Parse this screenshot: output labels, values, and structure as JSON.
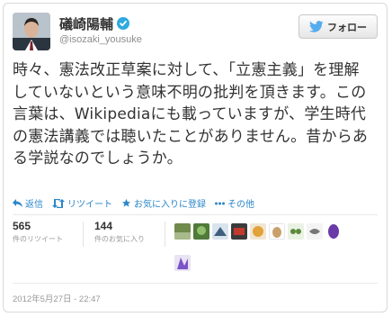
{
  "user": {
    "name": "礒崎陽輔",
    "handle": "@isozaki_yousuke",
    "avatar_icon": "person-avatar"
  },
  "follow_button": {
    "label": "フォロー",
    "icon": "twitter-bird-icon"
  },
  "tweet": {
    "text": "時々、憲法改正草案に対して、「立憲主義」を理解していないという意味不明の批判を頂きます。この言葉は、Wikipediaにも載っていますが、学生時代の憲法講義では聴いたことがありません。昔からある学説なのでしょうか。"
  },
  "actions": [
    {
      "label": "返信",
      "icon": "reply-icon"
    },
    {
      "label": "リツイート",
      "icon": "retweet-icon"
    },
    {
      "label": "お気に入りに登録",
      "icon": "favorite-star-icon"
    },
    {
      "label": "その他",
      "icon": "more-dots-icon"
    }
  ],
  "stats": {
    "retweets": {
      "count": "565",
      "label": "件のリツイート"
    },
    "favorites": {
      "count": "144",
      "label": "件のお気に入り"
    }
  },
  "timestamp": "2012年5月27日 - 22:47",
  "colors": {
    "link": "#2a86c9",
    "verified": "#2fa9e0",
    "text": "#333333",
    "muted": "#999999"
  }
}
